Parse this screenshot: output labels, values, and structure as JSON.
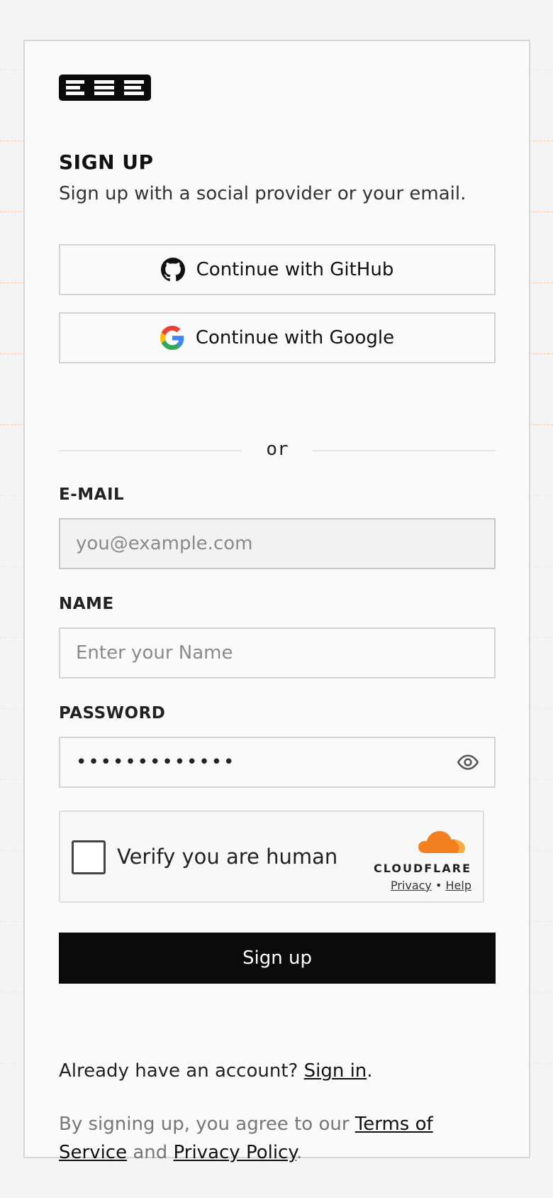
{
  "header": {
    "logo_text": "E2B"
  },
  "form": {
    "title": "SIGN UP",
    "subtitle": "Sign up with a social provider or your email.",
    "github_label": "Continue with GitHub",
    "google_label": "Continue with Google",
    "divider_text": "or",
    "email_label": "E-MAIL",
    "email_placeholder": "you@example.com",
    "name_label": "NAME",
    "name_placeholder": "Enter your Name",
    "password_label": "PASSWORD",
    "password_value": "•••••••••••••",
    "submit_label": "Sign up"
  },
  "captcha": {
    "text": "Verify you are human",
    "brand": "CLOUDFLARE",
    "privacy": "Privacy",
    "separator": "•",
    "help": "Help",
    "brand_color": "#f38020"
  },
  "footer": {
    "signin_prefix": "Already have an account?",
    "signin_link": "Sign in",
    "signin_suffix": ".",
    "legal_prefix": "By signing up, you agree to our",
    "terms_link": "Terms of Service",
    "legal_and": "and",
    "privacy_link": "Privacy Policy",
    "legal_suffix": "."
  }
}
